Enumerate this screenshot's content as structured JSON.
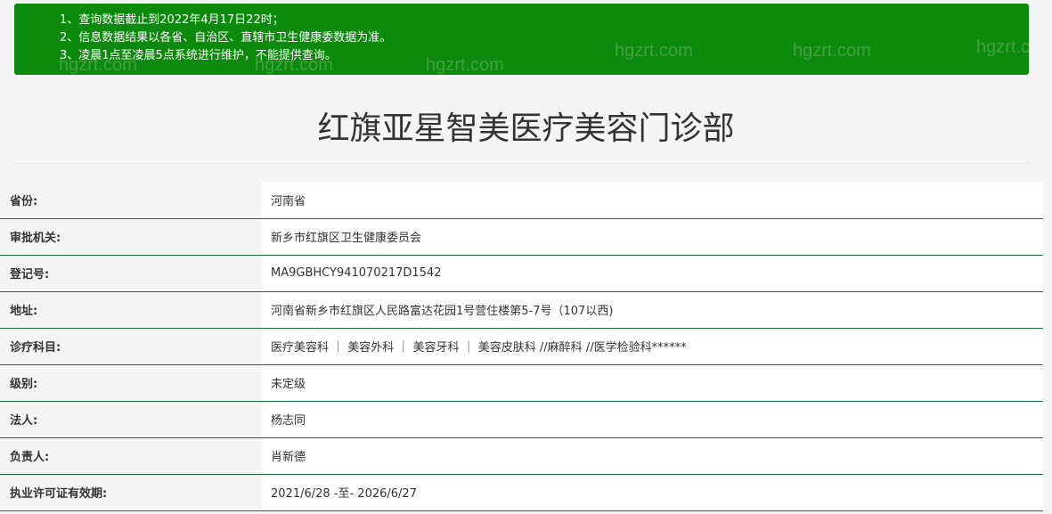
{
  "notice": {
    "lines": [
      "1、查询数据截止到2022年4月17日22时；",
      "2、信息数据结果以各省、自治区、直辖市卫生健康委数据为准。",
      "3、凌晨1点至凌晨5点系统进行维护，不能提供查询。"
    ],
    "background_color": "#0b8a0b"
  },
  "watermark": {
    "text": "hgzrt.com"
  },
  "page_title": "红旗亚星智美医疗美容门诊部",
  "table": {
    "border_color": "#1c6e3a",
    "rows": [
      {
        "label": "省份:",
        "value": "河南省"
      },
      {
        "label": "审批机关:",
        "value": "新乡市红旗区卫生健康委员会"
      },
      {
        "label": "登记号:",
        "value": "MA9GBHCY941070217D1542"
      },
      {
        "label": "地址:",
        "value": "河南省新乡市红旗区人民路富达花园1号营住楼第5-7号（107以西)"
      },
      {
        "label": "诊疗科目:",
        "value": "医疗美容科 ｜ 美容外科 ｜ 美容牙科 ｜ 美容皮肤科 //麻醉科 //医学检验科******"
      },
      {
        "label": "级别:",
        "value": "未定级"
      },
      {
        "label": "法人:",
        "value": "杨志同"
      },
      {
        "label": "负责人:",
        "value": "肖新德"
      },
      {
        "label": "执业许可证有效期:",
        "value": "2021/6/28 -至- 2026/6/27"
      }
    ]
  }
}
